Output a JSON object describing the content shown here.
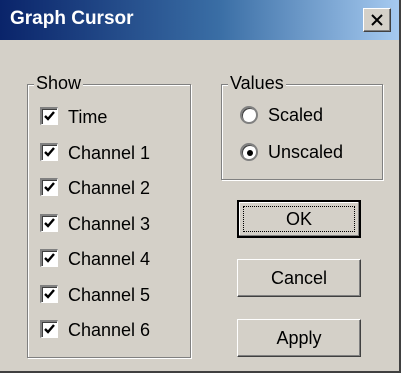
{
  "window": {
    "title": "Graph Cursor",
    "close_icon": "close-icon"
  },
  "show_group": {
    "label": "Show",
    "items": [
      {
        "label": "Time",
        "checked": true
      },
      {
        "label": "Channel 1",
        "checked": true
      },
      {
        "label": "Channel 2",
        "checked": true
      },
      {
        "label": "Channel 3",
        "checked": true
      },
      {
        "label": "Channel 4",
        "checked": true
      },
      {
        "label": "Channel 5",
        "checked": true
      },
      {
        "label": "Channel 6",
        "checked": true
      }
    ]
  },
  "values_group": {
    "label": "Values",
    "options": [
      {
        "label": "Scaled",
        "selected": false
      },
      {
        "label": "Unscaled",
        "selected": true
      }
    ]
  },
  "buttons": {
    "ok": "OK",
    "cancel": "Cancel",
    "apply": "Apply"
  }
}
